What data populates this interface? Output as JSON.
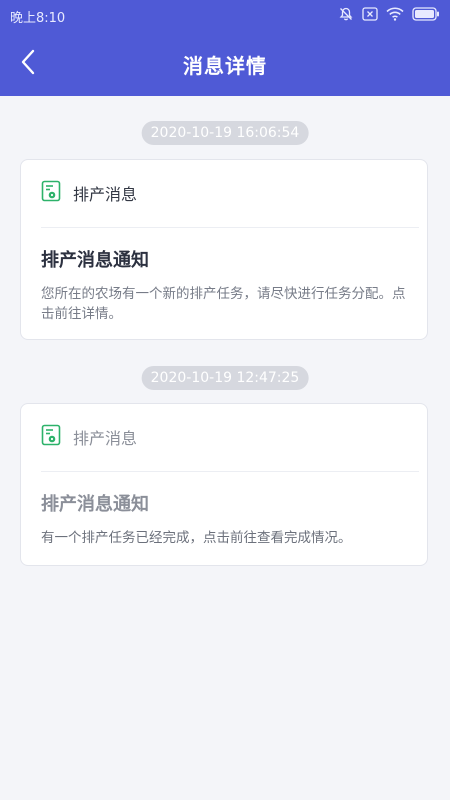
{
  "status_bar": {
    "time": "晚上8:10"
  },
  "header": {
    "title": "消息详情",
    "back_icon": "chevron-left-icon"
  },
  "colors": {
    "header_bg": "#4f5ad6",
    "page_bg": "#f4f5f9",
    "icon_green": "#2db26a"
  },
  "messages": [
    {
      "timestamp": "2020-10-19 16:06:54",
      "category": "排产消息",
      "icon": "schedule-doc-icon",
      "title": "排产消息通知",
      "body": "您所在的农场有一个新的排产任务，请尽快进行任务分配。点击前往详情。",
      "read": false
    },
    {
      "timestamp": "2020-10-19 12:47:25",
      "category": "排产消息",
      "icon": "schedule-doc-icon",
      "title": "排产消息通知",
      "body": "有一个排产任务已经完成，点击前往查看完成情况。",
      "read": true
    }
  ]
}
